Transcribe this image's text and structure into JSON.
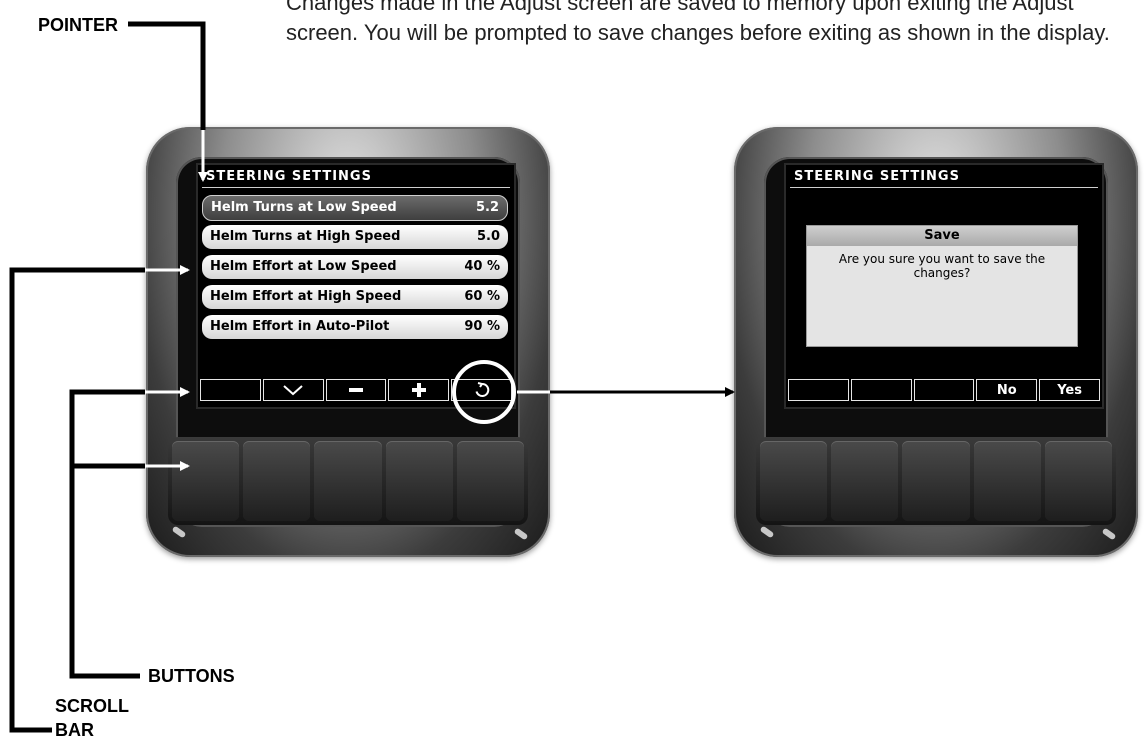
{
  "intro_text": "Changes made in the Adjust screen are saved to memory upon exiting the Adjust screen. You will be prompted to save changes before exiting as shown in the display.",
  "callouts": {
    "pointer": "POINTER",
    "buttons": "BUTTONS",
    "scroll_bar_line1": "SCROLL",
    "scroll_bar_line2": "BAR"
  },
  "left_display": {
    "title": "STEERING SETTINGS",
    "rows": [
      {
        "label": "Helm Turns at Low Speed",
        "value": "5.2",
        "selected": true
      },
      {
        "label": "Helm Turns at High Speed",
        "value": "5.0",
        "selected": false
      },
      {
        "label": "Helm Effort at Low Speed",
        "value": "40 %",
        "selected": false
      },
      {
        "label": "Helm Effort at High Speed",
        "value": "60 %",
        "selected": false
      },
      {
        "label": "Helm Effort in Auto-Pilot",
        "value": "90 %",
        "selected": false
      }
    ],
    "softkeys": [
      {
        "icon": "",
        "name": "softkey-blank"
      },
      {
        "icon": "chevron-down-icon",
        "name": "softkey-down"
      },
      {
        "icon": "minus-icon",
        "name": "softkey-minus"
      },
      {
        "icon": "plus-icon",
        "name": "softkey-plus"
      },
      {
        "icon": "undo-icon",
        "name": "softkey-back"
      }
    ]
  },
  "right_display": {
    "title": "STEERING SETTINGS",
    "dialog_title": "Save",
    "dialog_message": "Are you sure you want to save the changes?",
    "softkeys": [
      "",
      "",
      "",
      "No",
      "Yes"
    ]
  },
  "colors": {
    "selected_row": "#4f4f4f",
    "row": "#ffffff",
    "screen": "#000000",
    "callout_lines": "#000000"
  }
}
